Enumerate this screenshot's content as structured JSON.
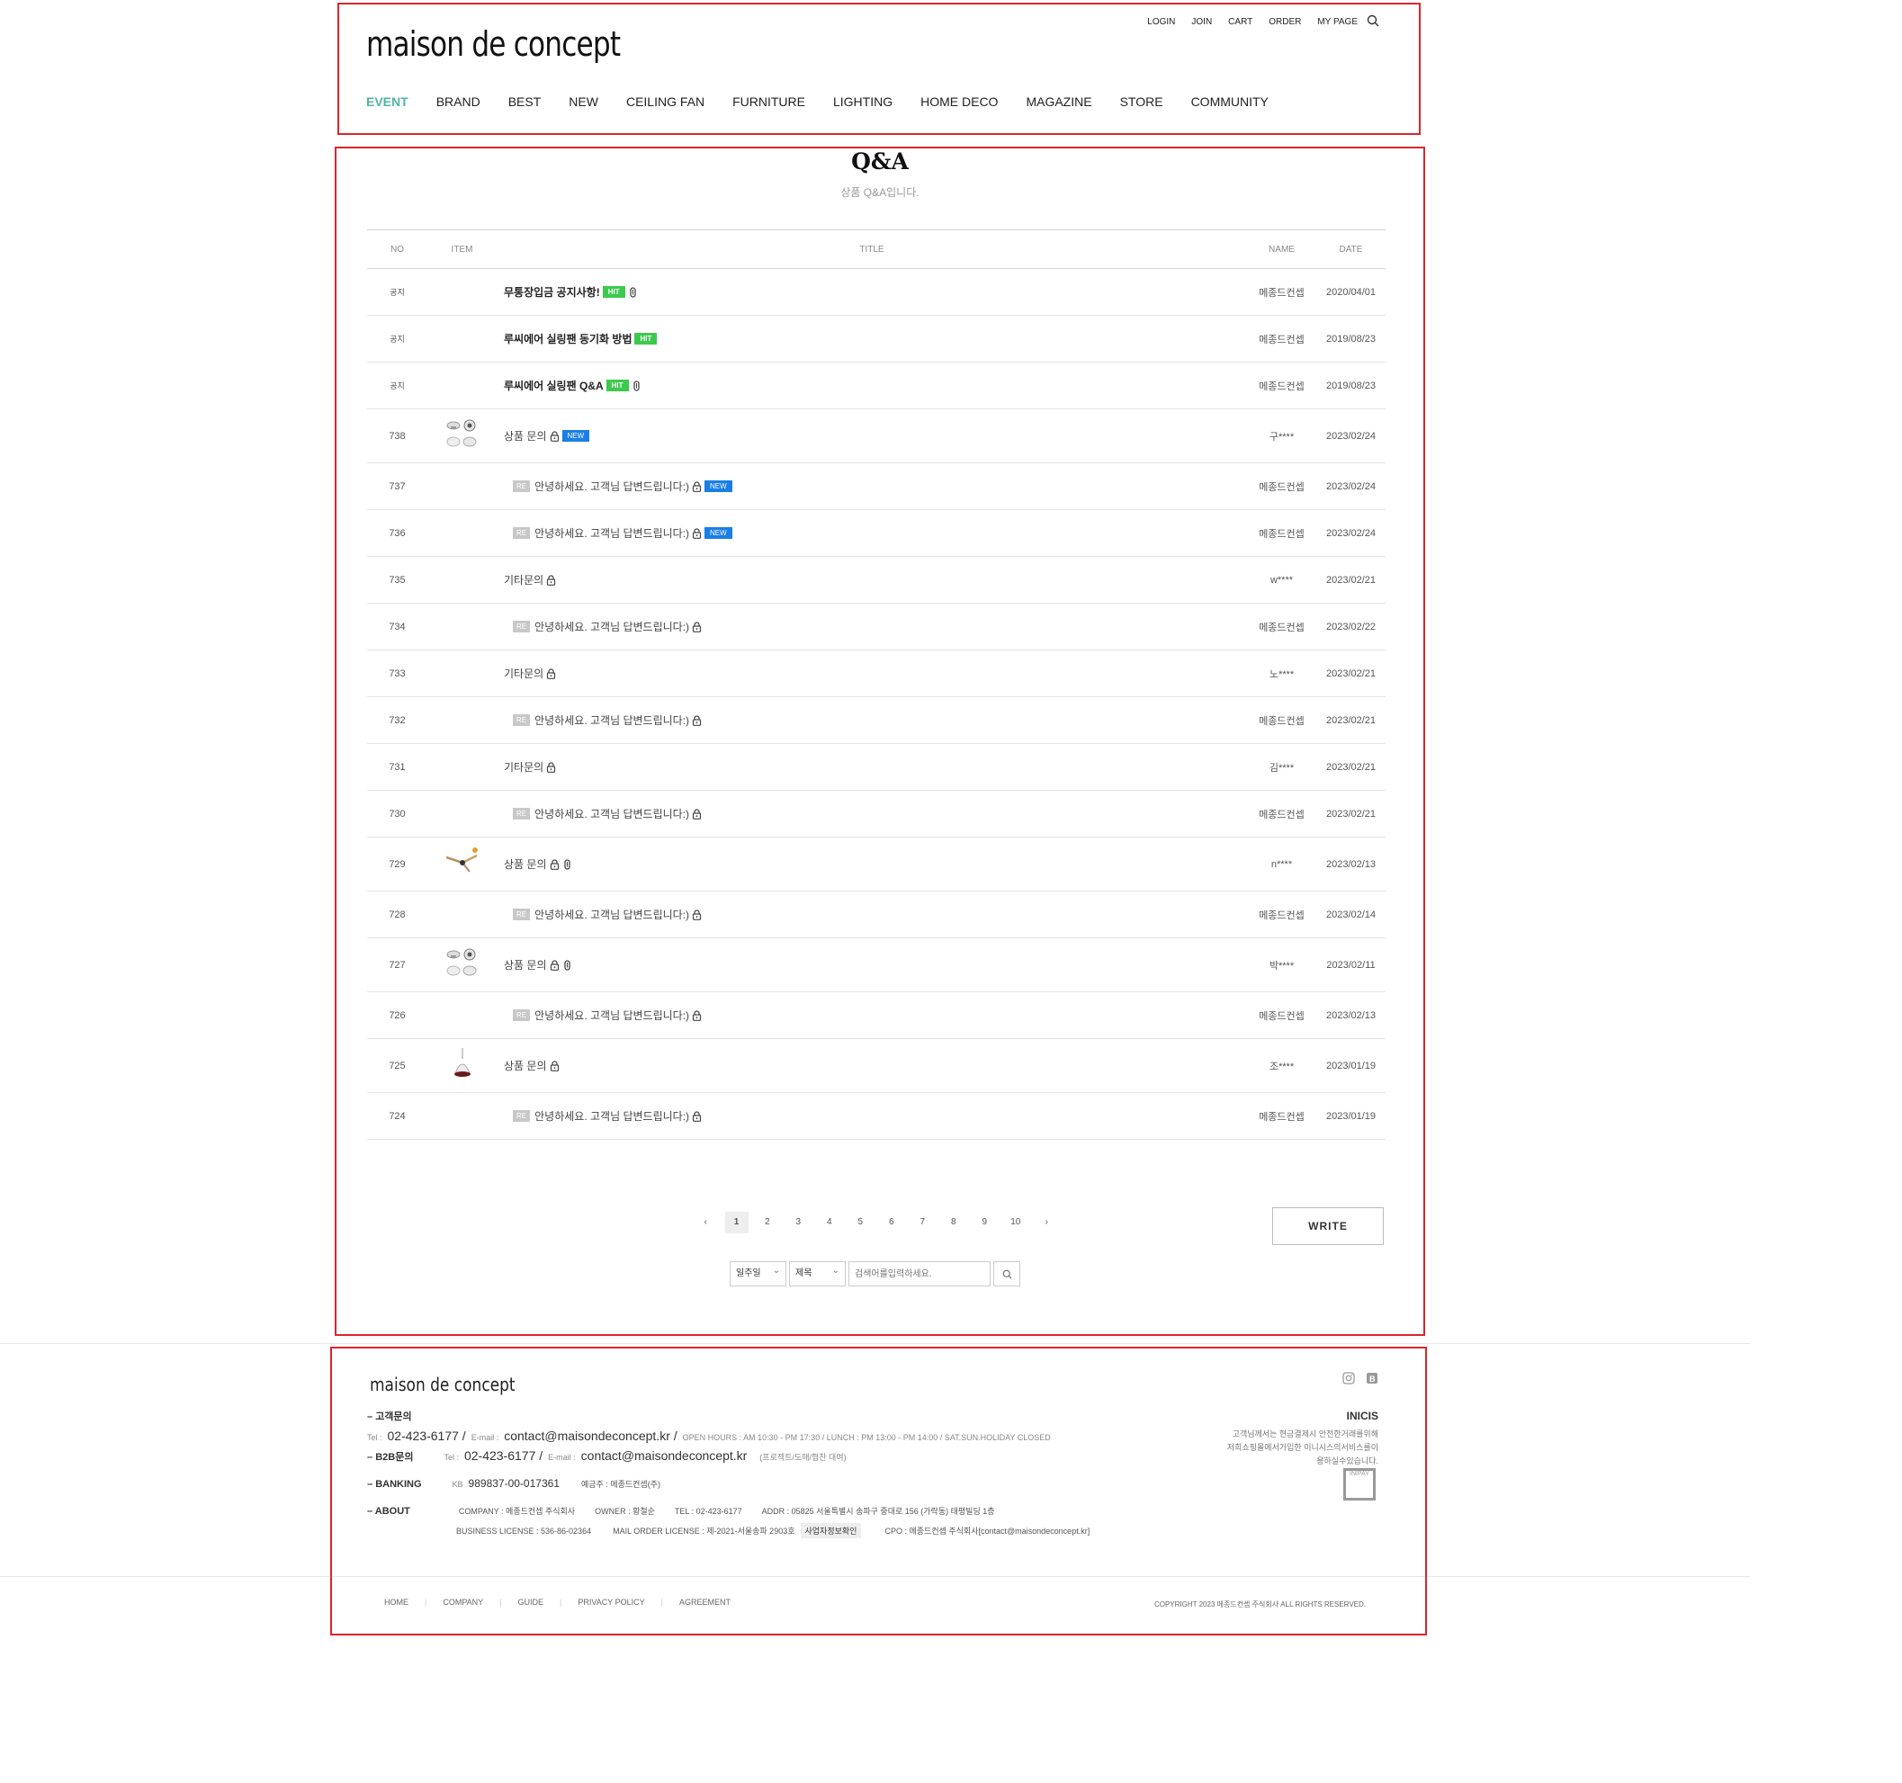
{
  "header": {
    "logo": "maison de concept",
    "util": [
      "LOGIN",
      "JOIN",
      "CART",
      "ORDER",
      "MY PAGE"
    ],
    "nav": [
      {
        "label": "EVENT",
        "active": true
      },
      {
        "label": "BRAND"
      },
      {
        "label": "BEST"
      },
      {
        "label": "NEW"
      },
      {
        "label": "CEILING FAN"
      },
      {
        "label": "FURNITURE"
      },
      {
        "label": "LIGHTING"
      },
      {
        "label": "HOME DECO"
      },
      {
        "label": "MAGAZINE"
      },
      {
        "label": "STORE"
      },
      {
        "label": "COMMUNITY"
      }
    ]
  },
  "board": {
    "title": "Q&A",
    "subtitle": "상품 Q&A입니다.",
    "columns": {
      "no": "NO",
      "item": "ITEM",
      "title": "TITLE",
      "name": "NAME",
      "date": "DATE"
    },
    "rows": [
      {
        "no": "공지",
        "thumb": "",
        "title": "무통장입금 공지사항!",
        "re": false,
        "badge": "HIT",
        "lock": false,
        "clip": true,
        "name": "메종드컨셉",
        "date": "2020/04/01",
        "notice": true
      },
      {
        "no": "공지",
        "thumb": "",
        "title": "루씨에어 실링팬 동기화 방법",
        "re": false,
        "badge": "HIT",
        "lock": false,
        "clip": false,
        "name": "메종드컨셉",
        "date": "2019/08/23",
        "notice": true
      },
      {
        "no": "공지",
        "thumb": "",
        "title": "루씨에어 실링팬 Q&A",
        "re": false,
        "badge": "HIT",
        "lock": false,
        "clip": true,
        "name": "메종드컨셉",
        "date": "2019/08/23",
        "notice": true
      },
      {
        "no": "738",
        "thumb": "lamp",
        "title": "상품 문의",
        "re": false,
        "badge": "NEW",
        "lock": true,
        "clip": false,
        "name": "구****",
        "date": "2023/02/24"
      },
      {
        "no": "737",
        "thumb": "",
        "title": "안녕하세요. 고객님 답변드립니다:)",
        "re": true,
        "badge": "NEW",
        "lock": true,
        "clip": false,
        "name": "메종드컨셉",
        "date": "2023/02/24"
      },
      {
        "no": "736",
        "thumb": "",
        "title": "안녕하세요. 고객님 답변드립니다:)",
        "re": true,
        "badge": "NEW",
        "lock": true,
        "clip": false,
        "name": "메종드컨셉",
        "date": "2023/02/24"
      },
      {
        "no": "735",
        "thumb": "",
        "title": "기타문의",
        "re": false,
        "badge": "",
        "lock": true,
        "clip": false,
        "name": "w****",
        "date": "2023/02/21"
      },
      {
        "no": "734",
        "thumb": "",
        "title": "안녕하세요. 고객님 답변드립니다:)",
        "re": true,
        "badge": "",
        "lock": true,
        "clip": false,
        "name": "메종드컨셉",
        "date": "2023/02/22"
      },
      {
        "no": "733",
        "thumb": "",
        "title": "기타문의",
        "re": false,
        "badge": "",
        "lock": true,
        "clip": false,
        "name": "노****",
        "date": "2023/02/21"
      },
      {
        "no": "732",
        "thumb": "",
        "title": "안녕하세요. 고객님 답변드립니다:)",
        "re": true,
        "badge": "",
        "lock": true,
        "clip": false,
        "name": "메종드컨셉",
        "date": "2023/02/21"
      },
      {
        "no": "731",
        "thumb": "",
        "title": "기타문의",
        "re": false,
        "badge": "",
        "lock": true,
        "clip": false,
        "name": "김****",
        "date": "2023/02/21"
      },
      {
        "no": "730",
        "thumb": "",
        "title": "안녕하세요. 고객님 답변드립니다:)",
        "re": true,
        "badge": "",
        "lock": true,
        "clip": false,
        "name": "메종드컨셉",
        "date": "2023/02/21"
      },
      {
        "no": "729",
        "thumb": "fan",
        "title": "상품 문의",
        "re": false,
        "badge": "",
        "lock": true,
        "clip": true,
        "name": "n****",
        "date": "2023/02/13"
      },
      {
        "no": "728",
        "thumb": "",
        "title": "안녕하세요. 고객님 답변드립니다:)",
        "re": true,
        "badge": "",
        "lock": true,
        "clip": false,
        "name": "메종드컨셉",
        "date": "2023/02/14"
      },
      {
        "no": "727",
        "thumb": "lamp",
        "title": "상품 문의",
        "re": false,
        "badge": "",
        "lock": true,
        "clip": true,
        "name": "박****",
        "date": "2023/02/11"
      },
      {
        "no": "726",
        "thumb": "",
        "title": "안녕하세요. 고객님 답변드립니다:)",
        "re": true,
        "badge": "",
        "lock": true,
        "clip": false,
        "name": "메종드컨셉",
        "date": "2023/02/13"
      },
      {
        "no": "725",
        "thumb": "bulb",
        "title": "상품 문의",
        "re": false,
        "badge": "",
        "lock": true,
        "clip": false,
        "name": "조****",
        "date": "2023/01/19"
      },
      {
        "no": "724",
        "thumb": "",
        "title": "안녕하세요. 고객님 답변드립니다:)",
        "re": true,
        "badge": "",
        "lock": true,
        "clip": false,
        "name": "메종드컨셉",
        "date": "2023/01/19"
      }
    ],
    "re_label": "RE",
    "pagination": {
      "prev": "‹",
      "next": "›",
      "pages": [
        "1",
        "2",
        "3",
        "4",
        "5",
        "6",
        "7",
        "8",
        "9",
        "10"
      ],
      "current": "1"
    },
    "write_label": "WRITE",
    "search": {
      "period": "일주일",
      "field": "제목",
      "placeholder": "검색어를입력하세요."
    }
  },
  "footer": {
    "logo": "maison de concept",
    "cs": {
      "label": "고객문의",
      "tel_label": "Tel :",
      "tel": "02-423-6177 /",
      "email_label": "E-mail :",
      "email": "contact@maisondeconcept.kr /",
      "hours": "OPEN HOURS : AM 10:30 - PM 17:30 / LUNCH : PM 13:00 - PM 14:00 / SAT.SUN.HOLIDAY CLOSED"
    },
    "b2b": {
      "label": "B2B문의",
      "tel_label": "Tel :",
      "tel": "02-423-6177 /",
      "email_label": "E-mail :",
      "email": "contact@maisondeconcept.kr",
      "note": "(프로젝트/도매/협찬 대여)"
    },
    "banking": {
      "label": "BANKING",
      "bank": "KB",
      "account": "989837-00-017361",
      "holder": "예금주 : 메종드컨셉(주)"
    },
    "about": {
      "label": "ABOUT",
      "company": "COMPANY : 메종드컨셉 주식회사",
      "owner": "OWNER : 황철순",
      "tel": "TEL : 02-423-6177",
      "addr": "ADDR : 05825 서울특별시 송파구 중대로 156 (가락동) 태평빌딩 1층",
      "license": "BUSINESS LICENSE : 536-86-02364",
      "mail_order": "MAIL ORDER LICENSE : 제-2021-서울송파 2903호",
      "biz_check": "사업자정보확인",
      "cpo": "CPO : 메종드컨셉 주식회사[contact@maisondeconcept.kr]"
    },
    "inicis_title": "INICIS",
    "inicis_text": "고객님께서는 현금결제시 안전한거래를위해 저희쇼핑몰에서가입한 이니시스의서비스를이용하실수있습니다.",
    "inipay": "INIPAY",
    "nav": [
      "HOME",
      "COMPANY",
      "GUIDE",
      "PRIVACY POLICY",
      "AGREEMENT"
    ],
    "copyright": "COPYRIGHT 2023 메종드컨셉 주식회사 ALL RIGHTS RESERVED."
  }
}
